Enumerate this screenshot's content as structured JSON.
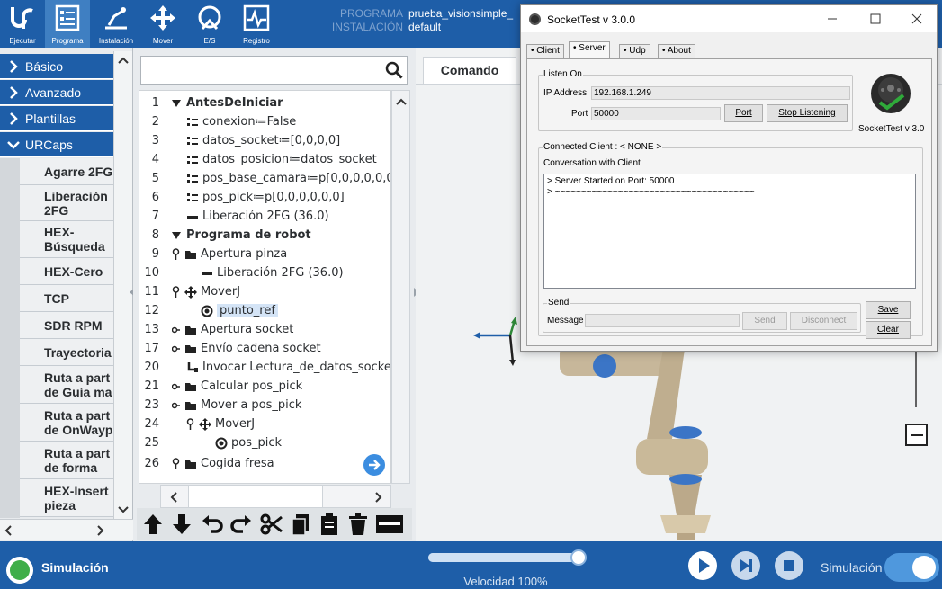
{
  "topbar": {
    "buttons": [
      {
        "label": "Ejecutar",
        "icon": "ur-logo-icon"
      },
      {
        "label": "Programa",
        "icon": "program-icon"
      },
      {
        "label": "Instalación",
        "icon": "installation-icon"
      },
      {
        "label": "Mover",
        "icon": "move-icon"
      },
      {
        "label": "E/S",
        "icon": "io-icon"
      },
      {
        "label": "Registro",
        "icon": "log-icon"
      }
    ],
    "program_key": "PROGRAMA",
    "program_value": "prueba_visionsimple_",
    "installation_key": "INSTALACIÓN",
    "installation_value": "default"
  },
  "categories": {
    "items": [
      {
        "label": "Básico",
        "expanded": false
      },
      {
        "label": "Avanzado",
        "expanded": false
      },
      {
        "label": "Plantillas",
        "expanded": false
      },
      {
        "label": "URCaps",
        "expanded": true
      }
    ],
    "subitems": [
      "Agarre 2FG",
      "Liberación 2FG",
      "HEX-Búsqueda",
      "HEX-Cero",
      "TCP",
      "SDR RPM",
      "Trayectoria",
      "Ruta a part de Guía ma",
      "Ruta a part de OnWayp",
      "Ruta a part de forma",
      "HEX-Insert pieza"
    ]
  },
  "search": {
    "value": ""
  },
  "tree": {
    "rows": [
      {
        "num": "1",
        "text": "AntesDeIniciar",
        "bold": true
      },
      {
        "num": "2",
        "text": "conexion≔False"
      },
      {
        "num": "3",
        "text": "datos_socket≔[0,0,0,0]"
      },
      {
        "num": "4",
        "text": "datos_posicion≔datos_socket"
      },
      {
        "num": "5",
        "text": "pos_base_camara≔p[0,0,0,0,0,0]"
      },
      {
        "num": "6",
        "text": "pos_pick≔p[0,0,0,0,0,0]"
      },
      {
        "num": "7",
        "text": "Liberación 2FG (36.0)"
      },
      {
        "num": "8",
        "text": "Programa de robot",
        "bold": true
      },
      {
        "num": "9",
        "text": "Apertura pinza"
      },
      {
        "num": "10",
        "text": "Liberación 2FG (36.0)"
      },
      {
        "num": "11",
        "text": "MoverJ"
      },
      {
        "num": "12",
        "text": "punto_ref"
      },
      {
        "num": "13",
        "text": "Apertura socket"
      },
      {
        "num": "17",
        "text": "Envío cadena socket"
      },
      {
        "num": "20",
        "text": "Invocar Lectura_de_datos_socket"
      },
      {
        "num": "21",
        "text": "Calcular pos_pick"
      },
      {
        "num": "23",
        "text": "Mover a pos_pick"
      },
      {
        "num": "24",
        "text": "MoverJ"
      },
      {
        "num": "25",
        "text": "pos_pick"
      },
      {
        "num": "26",
        "text": "Cogida fresa"
      }
    ]
  },
  "workspace": {
    "tab_label": "Comando"
  },
  "bottombar": {
    "status_label": "Simulación",
    "speed_label": "Velocidad 100%",
    "speed_fraction": 0.97,
    "mode_label": "Simulación",
    "simulation_on": true
  },
  "socketwin": {
    "title": "SocketTest v 3.0.0",
    "tabs": [
      "Client",
      "Server",
      "Udp",
      "About"
    ],
    "active_tab": "Server",
    "listen_group": "Listen On",
    "ip_label": "IP Address",
    "ip_value": "192.168.1.249",
    "port_label": "Port",
    "port_value": "50000",
    "port_button": "Port",
    "stop_button": "Stop Listening",
    "logo_caption": "SocketTest v 3.0",
    "connected_label": "Connected Client : < NONE >",
    "conversation_label": "Conversation with Client",
    "log_lines": [
      "> Server Started on Port: 50000",
      "> ~~~~~~~~~~~~~~~~~~~~~~~~~~~~~~~~~~~~~~"
    ],
    "send_group": "Send",
    "message_label": "Message",
    "message_value": "",
    "send_button": "Send",
    "disconnect_button": "Disconnect",
    "save_button": "Save",
    "clear_button": "Clear"
  },
  "colors": {
    "brand_blue": "#1e5ea8",
    "status_green": "#3fae49",
    "selection": "#d4e4f6"
  }
}
